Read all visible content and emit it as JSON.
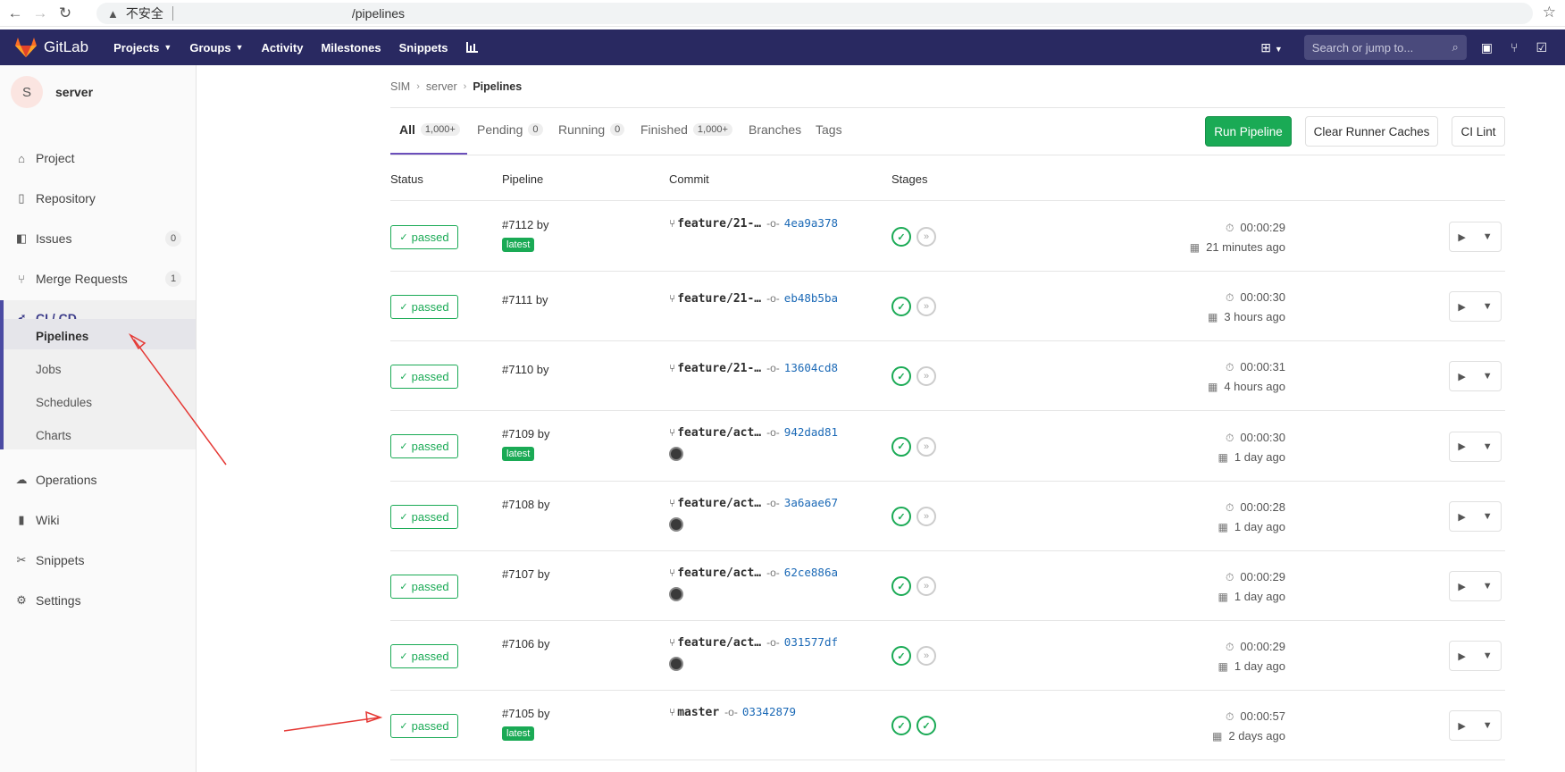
{
  "browser": {
    "security_label": "不安全",
    "url_path": "/pipelines"
  },
  "topnav": {
    "logo_text": "GitLab",
    "items": [
      "Projects",
      "Groups",
      "Activity",
      "Milestones",
      "Snippets"
    ],
    "search_placeholder": "Search or jump to..."
  },
  "sidebar": {
    "avatar_letter": "S",
    "project_name": "server",
    "items": [
      {
        "label": "Project",
        "icon": "home-icon"
      },
      {
        "label": "Repository",
        "icon": "book-icon"
      },
      {
        "label": "Issues",
        "icon": "issues-icon",
        "count": "0"
      },
      {
        "label": "Merge Requests",
        "icon": "merge-request-icon",
        "count": "1"
      },
      {
        "label": "CI / CD",
        "icon": "rocket-icon"
      },
      {
        "label": "Operations",
        "icon": "operations-icon"
      },
      {
        "label": "Wiki",
        "icon": "wiki-icon"
      },
      {
        "label": "Snippets",
        "icon": "snippets-icon"
      },
      {
        "label": "Settings",
        "icon": "settings-icon"
      }
    ],
    "cicd_sub": [
      "Pipelines",
      "Jobs",
      "Schedules",
      "Charts"
    ]
  },
  "breadcrumb": [
    "SIM",
    "server",
    "Pipelines"
  ],
  "tabs": [
    {
      "label": "All",
      "count": "1,000+"
    },
    {
      "label": "Pending",
      "count": "0"
    },
    {
      "label": "Running",
      "count": "0"
    },
    {
      "label": "Finished",
      "count": "1,000+"
    },
    {
      "label": "Branches"
    },
    {
      "label": "Tags"
    }
  ],
  "buttons": {
    "run_pipeline": "Run Pipeline",
    "clear_caches": "Clear Runner Caches",
    "ci_lint": "CI Lint"
  },
  "columns": [
    "Status",
    "Pipeline",
    "Commit",
    "Stages"
  ],
  "pipelines": [
    {
      "status": "passed",
      "id": "#7112 by",
      "latest": "latest",
      "branch": "feature/21-…",
      "sha": "4ea9a378",
      "author": false,
      "stages": [
        "ok",
        "skip"
      ],
      "duration": "00:00:29",
      "ago": "21 minutes ago"
    },
    {
      "status": "passed",
      "id": "#7111 by",
      "latest": null,
      "branch": "feature/21-…",
      "sha": "eb48b5ba",
      "author": false,
      "stages": [
        "ok",
        "skip"
      ],
      "duration": "00:00:30",
      "ago": "3 hours ago"
    },
    {
      "status": "passed",
      "id": "#7110 by",
      "latest": null,
      "branch": "feature/21-…",
      "sha": "13604cd8",
      "author": false,
      "stages": [
        "ok",
        "skip"
      ],
      "duration": "00:00:31",
      "ago": "4 hours ago"
    },
    {
      "status": "passed",
      "id": "#7109 by",
      "latest": "latest",
      "branch": "feature/act…",
      "sha": "942dad81",
      "author": true,
      "stages": [
        "ok",
        "skip"
      ],
      "duration": "00:00:30",
      "ago": "1 day ago"
    },
    {
      "status": "passed",
      "id": "#7108 by",
      "latest": null,
      "branch": "feature/act…",
      "sha": "3a6aae67",
      "author": true,
      "stages": [
        "ok",
        "skip"
      ],
      "duration": "00:00:28",
      "ago": "1 day ago"
    },
    {
      "status": "passed",
      "id": "#7107 by",
      "latest": null,
      "branch": "feature/act…",
      "sha": "62ce886a",
      "author": true,
      "stages": [
        "ok",
        "skip"
      ],
      "duration": "00:00:29",
      "ago": "1 day ago"
    },
    {
      "status": "passed",
      "id": "#7106 by",
      "latest": null,
      "branch": "feature/act…",
      "sha": "031577df",
      "author": true,
      "stages": [
        "ok",
        "skip"
      ],
      "duration": "00:00:29",
      "ago": "1 day ago"
    },
    {
      "status": "passed",
      "id": "#7105 by",
      "latest": "latest",
      "branch": "master",
      "sha": "03342879",
      "author": false,
      "stages": [
        "ok",
        "ok"
      ],
      "duration": "00:00:57",
      "ago": "2 days ago"
    }
  ],
  "colors": {
    "nav_bg": "#292961",
    "success": "#1aaa55",
    "accent": "#6b4fbb",
    "annotation": "#e53935"
  }
}
